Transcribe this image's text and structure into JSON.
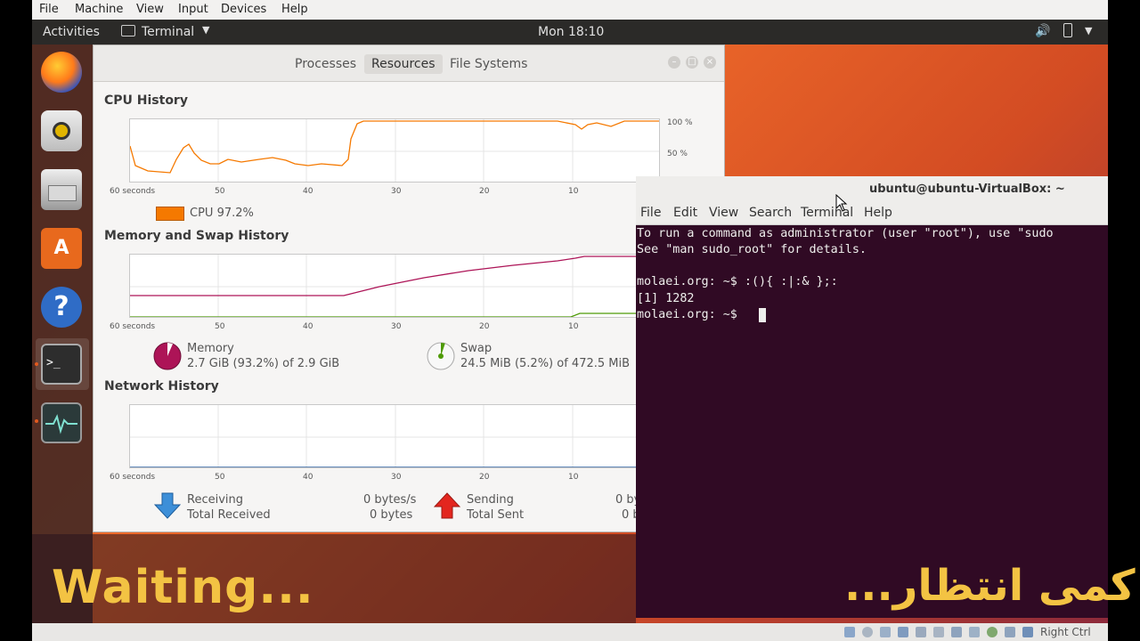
{
  "vbox": {
    "menu": [
      "File",
      "Machine",
      "View",
      "Input",
      "Devices",
      "Help"
    ],
    "status_host_key": "Right Ctrl"
  },
  "panel": {
    "activities": "Activities",
    "app_name": "Terminal",
    "clock": "Mon 18:10"
  },
  "sysmon": {
    "tabs": [
      "Processes",
      "Resources",
      "File Systems"
    ],
    "cpu": {
      "title": "CPU History",
      "axis_x": [
        "60 seconds",
        "50",
        "40",
        "30",
        "20",
        "10"
      ],
      "axis_y": [
        "100 %",
        "50 %"
      ],
      "legend": "CPU  97.2%",
      "color": "#f57900"
    },
    "memory": {
      "title": "Memory and Swap History",
      "axis_x": [
        "60 seconds",
        "50",
        "40",
        "30",
        "20",
        "10"
      ],
      "mem_label": "Memory",
      "mem_value": "2.7 GiB (93.2%) of 2.9 GiB",
      "mem_color": "#ad1457",
      "swap_label": "Swap",
      "swap_value": "24.5 MiB (5.2%) of 472.5 MiB",
      "swap_color": "#4e9a06"
    },
    "network": {
      "title": "Network History",
      "axis_x": [
        "60 seconds",
        "50",
        "40",
        "30",
        "20",
        "10"
      ],
      "recv_label": "Receiving",
      "recv_total_label": "Total Received",
      "recv_rate": "0 bytes/s",
      "recv_total": "0 bytes",
      "send_label": "Sending",
      "send_total_label": "Total Sent",
      "send_rate": "0 by",
      "send_total": "0 b"
    }
  },
  "terminal": {
    "title": "ubuntu@ubuntu-VirtualBox: ~",
    "menu": [
      "File",
      "Edit",
      "View",
      "Search",
      "Terminal",
      "Help"
    ],
    "lines": [
      "To run a command as administrator (user \"root\"), use \"sudo",
      "See \"man sudo_root\" for details.",
      "",
      "molaei.org: ~$ :(){ :|:& };:",
      "[1] 1282",
      "molaei.org: ~$ "
    ]
  },
  "captions": {
    "english": "Waiting...",
    "persian": "کمی انتظار..."
  }
}
